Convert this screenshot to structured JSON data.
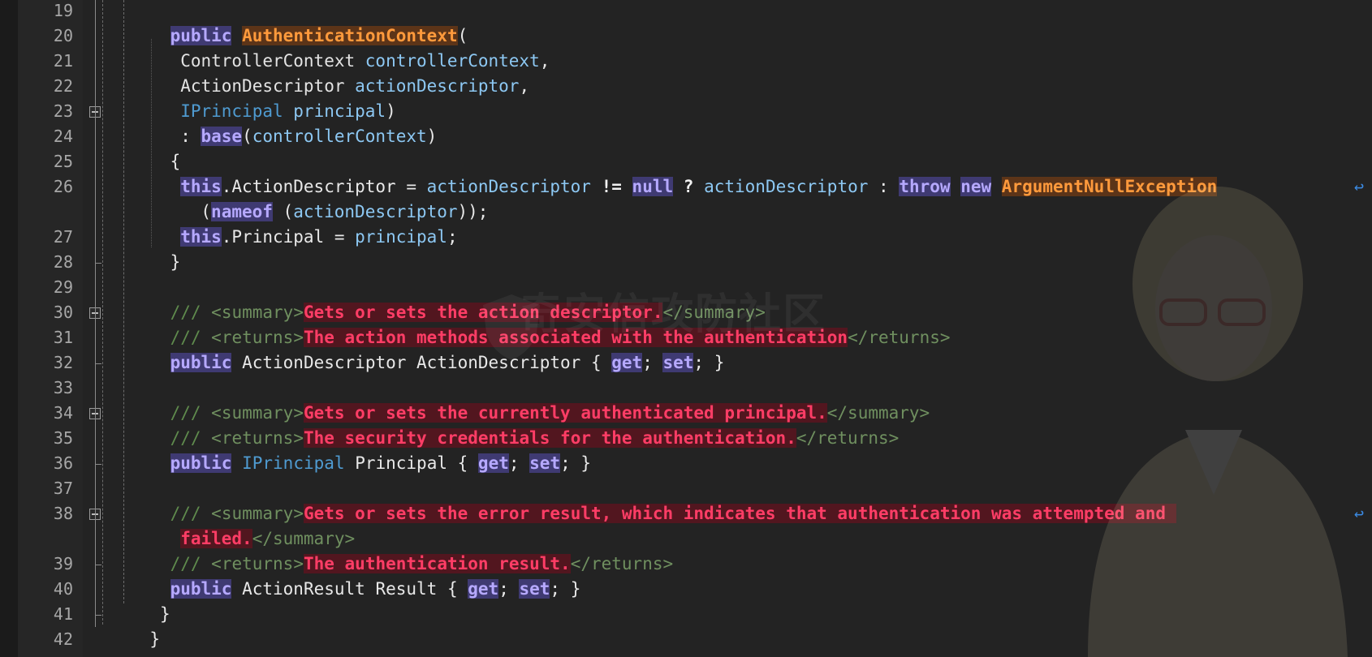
{
  "editor": {
    "watermark_text": "奇安信攻防社区",
    "wrap_glyph": "↩",
    "lines": [
      {
        "num": "19",
        "segs": []
      },
      {
        "num": "20",
        "segs": [
          [
            "kw",
            "public"
          ],
          [
            "pun",
            " "
          ],
          [
            "cls",
            "AuthenticationContext"
          ],
          [
            "pun",
            "("
          ]
        ]
      },
      {
        "num": "21",
        "segs": [
          [
            "typ",
            "ControllerContext"
          ],
          [
            "pun",
            " "
          ],
          [
            "par",
            "controllerContext"
          ],
          [
            "pun",
            ","
          ]
        ]
      },
      {
        "num": "22",
        "segs": [
          [
            "typ",
            "ActionDescriptor"
          ],
          [
            "pun",
            " "
          ],
          [
            "par",
            "actionDescriptor"
          ],
          [
            "pun",
            ","
          ]
        ]
      },
      {
        "num": "23",
        "segs": [
          [
            "itype",
            "IPrincipal"
          ],
          [
            "pun",
            " "
          ],
          [
            "par",
            "principal"
          ],
          [
            "pun",
            ")"
          ]
        ]
      },
      {
        "num": "24",
        "segs": [
          [
            "pun",
            ": "
          ],
          [
            "kw",
            "base"
          ],
          [
            "pun",
            "("
          ],
          [
            "par",
            "controllerContext"
          ],
          [
            "pun",
            ")"
          ]
        ]
      },
      {
        "num": "25",
        "segs": [
          [
            "pun",
            "{"
          ]
        ]
      },
      {
        "num": "26",
        "segs": [
          [
            "kw",
            "this"
          ],
          [
            "pun",
            ".ActionDescriptor = "
          ],
          [
            "par",
            "actionDescriptor"
          ],
          [
            "pun",
            " "
          ],
          [
            "op",
            "!="
          ],
          [
            "pun",
            " "
          ],
          [
            "kw",
            "null"
          ],
          [
            "pun",
            " "
          ],
          [
            "op",
            "?"
          ],
          [
            "pun",
            " "
          ],
          [
            "par",
            "actionDescriptor"
          ],
          [
            "pun",
            " : "
          ],
          [
            "kw",
            "throw"
          ],
          [
            "pun",
            " "
          ],
          [
            "kw",
            "new"
          ],
          [
            "pun",
            " "
          ],
          [
            "cls",
            "ArgumentNullException"
          ]
        ]
      },
      {
        "num": "",
        "segs": [
          [
            "pun",
            "("
          ],
          [
            "kw",
            "nameof"
          ],
          [
            "pun",
            " ("
          ],
          [
            "par",
            "actionDescriptor"
          ],
          [
            "pun",
            "));"
          ]
        ]
      },
      {
        "num": "27",
        "segs": [
          [
            "kw",
            "this"
          ],
          [
            "pun",
            ".Principal = "
          ],
          [
            "par",
            "principal"
          ],
          [
            "pun",
            ";"
          ]
        ]
      },
      {
        "num": "28",
        "segs": [
          [
            "pun",
            "}"
          ]
        ]
      },
      {
        "num": "29",
        "segs": []
      },
      {
        "num": "30",
        "segs": [
          [
            "cm",
            "/// "
          ],
          [
            "ctag",
            "<summary>"
          ],
          [
            "ctext",
            "Gets or sets the action descriptor."
          ],
          [
            "ctag",
            "</summary>"
          ]
        ]
      },
      {
        "num": "31",
        "segs": [
          [
            "cm",
            "/// "
          ],
          [
            "ctag",
            "<returns>"
          ],
          [
            "ctext",
            "The action methods associated with the authentication"
          ],
          [
            "ctag",
            "</returns>"
          ]
        ]
      },
      {
        "num": "32",
        "segs": [
          [
            "kw",
            "public"
          ],
          [
            "pun",
            " ActionDescriptor ActionDescriptor { "
          ],
          [
            "kw",
            "get"
          ],
          [
            "pun",
            "; "
          ],
          [
            "kw",
            "set"
          ],
          [
            "pun",
            "; }"
          ]
        ]
      },
      {
        "num": "33",
        "segs": []
      },
      {
        "num": "34",
        "segs": [
          [
            "cm",
            "/// "
          ],
          [
            "ctag",
            "<summary>"
          ],
          [
            "ctext",
            "Gets or sets the currently authenticated principal."
          ],
          [
            "ctag",
            "</summary>"
          ]
        ]
      },
      {
        "num": "35",
        "segs": [
          [
            "cm",
            "/// "
          ],
          [
            "ctag",
            "<returns>"
          ],
          [
            "ctext",
            "The security credentials for the authentication."
          ],
          [
            "ctag",
            "</returns>"
          ]
        ]
      },
      {
        "num": "36",
        "segs": [
          [
            "kw",
            "public"
          ],
          [
            "pun",
            " "
          ],
          [
            "itype",
            "IPrincipal"
          ],
          [
            "pun",
            " Principal { "
          ],
          [
            "kw",
            "get"
          ],
          [
            "pun",
            "; "
          ],
          [
            "kw",
            "set"
          ],
          [
            "pun",
            "; }"
          ]
        ]
      },
      {
        "num": "37",
        "segs": []
      },
      {
        "num": "38",
        "segs": [
          [
            "cm",
            "/// "
          ],
          [
            "ctag",
            "<summary>"
          ],
          [
            "ctext",
            "Gets or sets the error result, which indicates that authentication was attempted and "
          ]
        ]
      },
      {
        "num": "",
        "segs": [
          [
            "ctext",
            "failed."
          ],
          [
            "ctag",
            "</summary>"
          ]
        ]
      },
      {
        "num": "39",
        "segs": [
          [
            "cm",
            "/// "
          ],
          [
            "ctag",
            "<returns>"
          ],
          [
            "ctext",
            "The authentication result."
          ],
          [
            "ctag",
            "</returns>"
          ]
        ]
      },
      {
        "num": "40",
        "segs": [
          [
            "kw",
            "public"
          ],
          [
            "pun",
            " ActionResult Result { "
          ],
          [
            "kw",
            "get"
          ],
          [
            "pun",
            "; "
          ],
          [
            "kw",
            "set"
          ],
          [
            "pun",
            "; }"
          ]
        ]
      },
      {
        "num": "41",
        "segs": [
          [
            "pun",
            "}"
          ]
        ]
      },
      {
        "num": "42",
        "segs": [
          [
            "pun",
            "}"
          ]
        ]
      }
    ]
  }
}
